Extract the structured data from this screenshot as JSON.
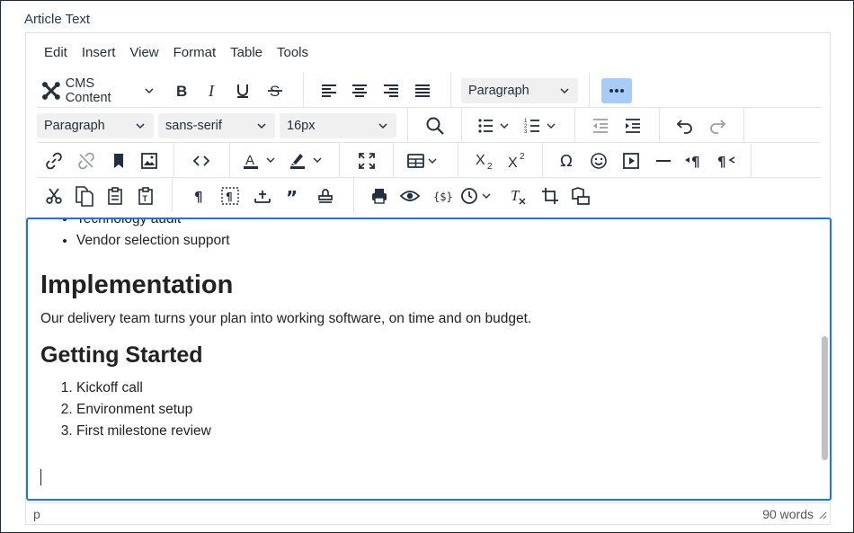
{
  "field_label": "Article Text",
  "menubar": [
    "Edit",
    "Insert",
    "View",
    "Format",
    "Table",
    "Tools"
  ],
  "toolbar": {
    "cms_content_label": "CMS Content",
    "block_format": "Paragraph",
    "block_format_2": "Paragraph",
    "font_family": "sans-serif",
    "font_size": "16px"
  },
  "content": {
    "list1": [
      "Technology audit",
      "Vendor selection support"
    ],
    "heading1": "Implementation",
    "para1": "Our delivery team turns your plan into working software, on time and on budget.",
    "heading2": "Getting Started",
    "list2": [
      "Kickoff call",
      "Environment setup",
      "First milestone review"
    ]
  },
  "statusbar": {
    "path": "p",
    "word_count": "90 words"
  },
  "colors": {
    "accent": "#1e73e8",
    "more_button_active": "#a6ccf7",
    "text": "#222f3e"
  }
}
